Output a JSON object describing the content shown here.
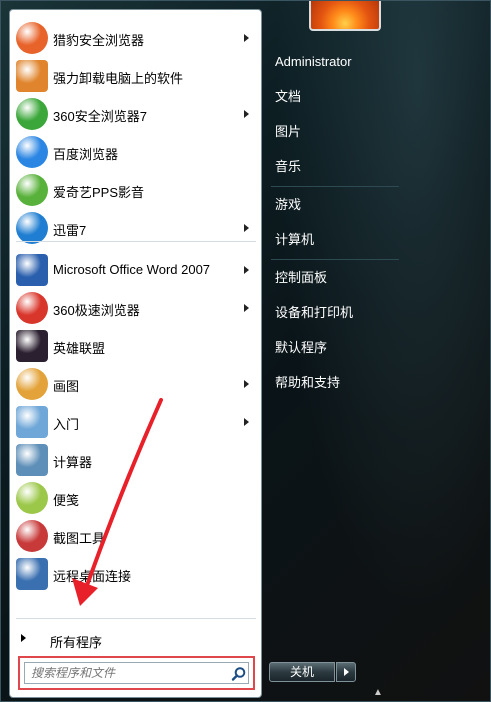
{
  "programs": [
    {
      "label": "猎豹安全浏览器",
      "icon": "cheetah-browser-icon",
      "color": "#e8632a",
      "submenu": true
    },
    {
      "label": "强力卸载电脑上的软件",
      "icon": "uninstall-box-icon",
      "color": "#e0852d",
      "submenu": false
    },
    {
      "label": "360安全浏览器7",
      "icon": "360-browser-icon",
      "color": "#3ba73a",
      "submenu": true
    },
    {
      "label": "百度浏览器",
      "icon": "baidu-browser-icon",
      "color": "#2b86e3",
      "submenu": false
    },
    {
      "label": "爱奇艺PPS影音",
      "icon": "iqiyi-pps-icon",
      "color": "#58b13a",
      "submenu": false
    },
    {
      "label": "迅雷7",
      "icon": "xunlei-bird-icon",
      "color": "#1f7ed1",
      "submenu": true
    },
    {
      "label": "Microsoft Office Word 2007",
      "icon": "word-icon",
      "color": "#2a5fad",
      "submenu": true
    },
    {
      "label": "360极速浏览器",
      "icon": "360-speed-browser-icon",
      "color": "#d9362b",
      "submenu": true
    },
    {
      "label": "英雄联盟",
      "icon": "league-of-legends-icon",
      "color": "#2b2030",
      "submenu": false
    },
    {
      "label": "画图",
      "icon": "paint-palette-icon",
      "color": "#e3a33a",
      "submenu": true
    },
    {
      "label": "入门",
      "icon": "getting-started-icon",
      "color": "#6fa7d8",
      "submenu": true
    },
    {
      "label": "计算器",
      "icon": "calculator-icon",
      "color": "#5e8fb8",
      "submenu": false
    },
    {
      "label": "便笺",
      "icon": "sticky-notes-icon",
      "color": "#9cc84a",
      "submenu": false
    },
    {
      "label": "截图工具",
      "icon": "snipping-tool-icon",
      "color": "#c83a3a",
      "submenu": false
    },
    {
      "label": "远程桌面连接",
      "icon": "remote-desktop-icon",
      "color": "#3a6fb0",
      "submenu": false
    }
  ],
  "all_programs_label": "所有程序",
  "search": {
    "placeholder": "搜索程序和文件"
  },
  "right_links": [
    "Administrator",
    "文档",
    "图片",
    "音乐",
    "游戏",
    "计算机",
    "控制面板",
    "设备和打印机",
    "默认程序",
    "帮助和支持"
  ],
  "shutdown_label": "关机",
  "annotation_color": "#e8202a"
}
